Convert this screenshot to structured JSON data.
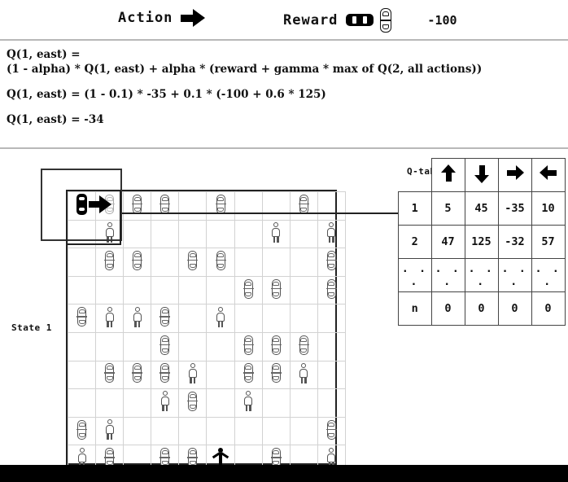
{
  "header": {
    "action_label": "Action",
    "action_icon": "arrow-right-icon",
    "reward_label": "Reward",
    "reward_icon": "car-collision-icon",
    "reward_value": "-100"
  },
  "equations": [
    {
      "lines": [
        "Q(1, east) =",
        "(1 - alpha) * Q(1, east) + alpha * (reward + gamma * max of Q(2, all actions))"
      ]
    },
    {
      "lines": [
        "Q(1, east) = (1 - 0.1) * -35 + 0.1 * (-100 + 0.6 * 125)"
      ]
    },
    {
      "lines": [
        "Q(1, east) = -34"
      ]
    }
  ],
  "gridworld": {
    "state_label": "State 1",
    "rows": 10,
    "cols": 10,
    "highlight": {
      "row": 0,
      "col": 0,
      "row_span": 2,
      "col_span": 2
    },
    "agent": {
      "row": 0,
      "col": 0,
      "icon": "black-car-icon"
    },
    "action_arrow": {
      "row": 0,
      "col": 1,
      "icon": "arrow-right-icon"
    },
    "goal": {
      "row": 9,
      "col": 5,
      "icon": "goal-person-icon"
    },
    "cells": [
      {
        "row": 0,
        "col": 1,
        "icon": "ghost-car-icon"
      },
      {
        "row": 0,
        "col": 2,
        "icon": "car-icon"
      },
      {
        "row": 0,
        "col": 3,
        "icon": "car-icon"
      },
      {
        "row": 0,
        "col": 5,
        "icon": "car-icon"
      },
      {
        "row": 0,
        "col": 8,
        "icon": "car-icon"
      },
      {
        "row": 1,
        "col": 1,
        "icon": "pedestrian-icon"
      },
      {
        "row": 1,
        "col": 7,
        "icon": "pedestrian-icon"
      },
      {
        "row": 1,
        "col": 9,
        "icon": "pedestrian-icon"
      },
      {
        "row": 2,
        "col": 1,
        "icon": "car-icon"
      },
      {
        "row": 2,
        "col": 2,
        "icon": "car-icon"
      },
      {
        "row": 2,
        "col": 4,
        "icon": "car-icon"
      },
      {
        "row": 2,
        "col": 5,
        "icon": "car-icon"
      },
      {
        "row": 2,
        "col": 9,
        "icon": "car-icon"
      },
      {
        "row": 3,
        "col": 6,
        "icon": "car-icon"
      },
      {
        "row": 3,
        "col": 7,
        "icon": "car-icon"
      },
      {
        "row": 3,
        "col": 9,
        "icon": "car-icon"
      },
      {
        "row": 4,
        "col": 0,
        "icon": "car-icon"
      },
      {
        "row": 4,
        "col": 1,
        "icon": "pedestrian-icon"
      },
      {
        "row": 4,
        "col": 2,
        "icon": "pedestrian-icon"
      },
      {
        "row": 4,
        "col": 3,
        "icon": "car-icon"
      },
      {
        "row": 4,
        "col": 5,
        "icon": "pedestrian-icon"
      },
      {
        "row": 5,
        "col": 3,
        "icon": "car-icon"
      },
      {
        "row": 5,
        "col": 6,
        "icon": "car-icon"
      },
      {
        "row": 5,
        "col": 7,
        "icon": "car-icon"
      },
      {
        "row": 5,
        "col": 8,
        "icon": "car-icon"
      },
      {
        "row": 6,
        "col": 1,
        "icon": "car-icon"
      },
      {
        "row": 6,
        "col": 2,
        "icon": "car-icon"
      },
      {
        "row": 6,
        "col": 3,
        "icon": "car-icon"
      },
      {
        "row": 6,
        "col": 4,
        "icon": "pedestrian-icon"
      },
      {
        "row": 6,
        "col": 6,
        "icon": "car-icon"
      },
      {
        "row": 6,
        "col": 7,
        "icon": "car-icon"
      },
      {
        "row": 6,
        "col": 8,
        "icon": "pedestrian-icon"
      },
      {
        "row": 7,
        "col": 3,
        "icon": "pedestrian-icon"
      },
      {
        "row": 7,
        "col": 4,
        "icon": "car-icon"
      },
      {
        "row": 7,
        "col": 6,
        "icon": "pedestrian-icon"
      },
      {
        "row": 8,
        "col": 0,
        "icon": "car-icon"
      },
      {
        "row": 8,
        "col": 1,
        "icon": "pedestrian-icon"
      },
      {
        "row": 8,
        "col": 9,
        "icon": "car-icon"
      },
      {
        "row": 9,
        "col": 0,
        "icon": "pedestrian-icon"
      },
      {
        "row": 9,
        "col": 1,
        "icon": "car-icon"
      },
      {
        "row": 9,
        "col": 3,
        "icon": "car-icon"
      },
      {
        "row": 9,
        "col": 4,
        "icon": "car-icon"
      },
      {
        "row": 9,
        "col": 7,
        "icon": "car-icon"
      },
      {
        "row": 9,
        "col": 9,
        "icon": "pedestrian-icon"
      }
    ]
  },
  "qtable": {
    "title": "Q-table",
    "columns": [
      {
        "icon": "arrow-up-icon",
        "name": "north"
      },
      {
        "icon": "arrow-down-icon",
        "name": "south"
      },
      {
        "icon": "arrow-right-icon",
        "name": "east"
      },
      {
        "icon": "arrow-left-icon",
        "name": "west"
      }
    ],
    "rows": [
      {
        "state": "1",
        "values": [
          "5",
          "45",
          "-35",
          "10"
        ]
      },
      {
        "state": "2",
        "values": [
          "47",
          "125",
          "-32",
          "57"
        ]
      },
      {
        "state": ". . .",
        "values": [
          ". . .",
          ". . .",
          ". . .",
          ". . ."
        ]
      },
      {
        "state": "n",
        "values": [
          "0",
          "0",
          "0",
          "0"
        ]
      }
    ]
  }
}
